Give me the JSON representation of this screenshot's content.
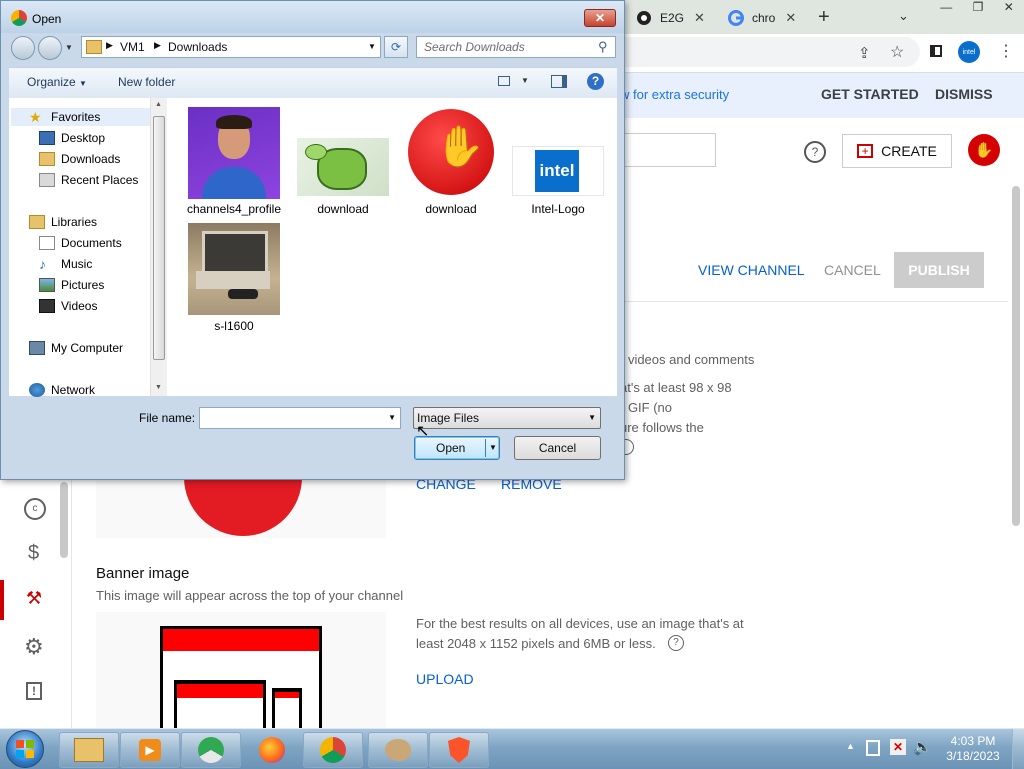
{
  "chrome": {
    "tabs": [
      {
        "label": "E2G",
        "icon": "chrome-icon"
      },
      {
        "label": "chro",
        "icon": "google-icon"
      }
    ],
    "new_tab_icon": "plus-icon",
    "banner": {
      "text": "w for extra security",
      "get_started": "GET STARTED",
      "dismiss": "DISMISS"
    }
  },
  "youtube": {
    "create_label": "CREATE",
    "view_channel": "VIEW CHANNEL",
    "cancel": "CANCEL",
    "publish": "PUBLISH",
    "picture_text_1": "r videos and comments",
    "picture_text_2": "at's at least 98 x 98",
    "picture_text_3": "r GIF (no",
    "picture_text_4": "ure follows the",
    "change": "CHANGE",
    "remove": "REMOVE",
    "banner_title": "Banner image",
    "banner_desc": "This image will appear across the top of your channel",
    "banner_hint_1": "For the best results on all devices, use an image that's at",
    "banner_hint_2": "least 2048 x 1152 pixels and 6MB or less.",
    "upload": "UPLOAD",
    "accent": "#065fd4"
  },
  "dialog": {
    "title": "Open",
    "breadcrumb": [
      "VM1",
      "Downloads"
    ],
    "search_placeholder": "Search Downloads",
    "organize": "Organize",
    "new_folder": "New folder",
    "nav": {
      "favorites": "Favorites",
      "desktop": "Desktop",
      "downloads": "Downloads",
      "recent": "Recent Places",
      "libraries": "Libraries",
      "documents": "Documents",
      "music": "Music",
      "pictures": "Pictures",
      "videos": "Videos",
      "computer": "My Computer",
      "network": "Network"
    },
    "files": [
      {
        "name": "channels4_profile"
      },
      {
        "name": "download"
      },
      {
        "name": "download"
      },
      {
        "name": "Intel-Logo"
      },
      {
        "name": "s-l1600"
      }
    ],
    "intel_logo_text": "intel",
    "file_name_label": "File name:",
    "file_name_value": "",
    "file_type": "Image Files",
    "open_button": "Open",
    "cancel_button": "Cancel"
  },
  "taskbar": {
    "time": "4:03 PM",
    "date": "3/18/2023"
  }
}
